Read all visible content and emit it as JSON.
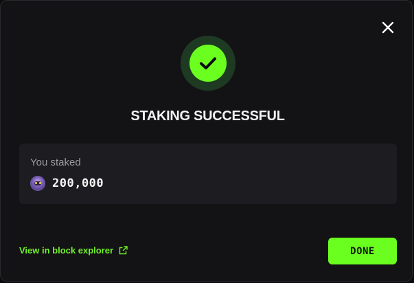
{
  "modal": {
    "title": "STAKING SUCCESSFUL",
    "close_icon": "close-icon",
    "status_icon": "checkmark-icon",
    "accent_color": "#6bff1f"
  },
  "stake": {
    "label": "You staked",
    "token_icon": "token-avatar-icon",
    "amount": "200,000"
  },
  "footer": {
    "explorer_link": "View in block explorer",
    "explorer_icon": "external-link-icon",
    "done_label": "DONE"
  }
}
